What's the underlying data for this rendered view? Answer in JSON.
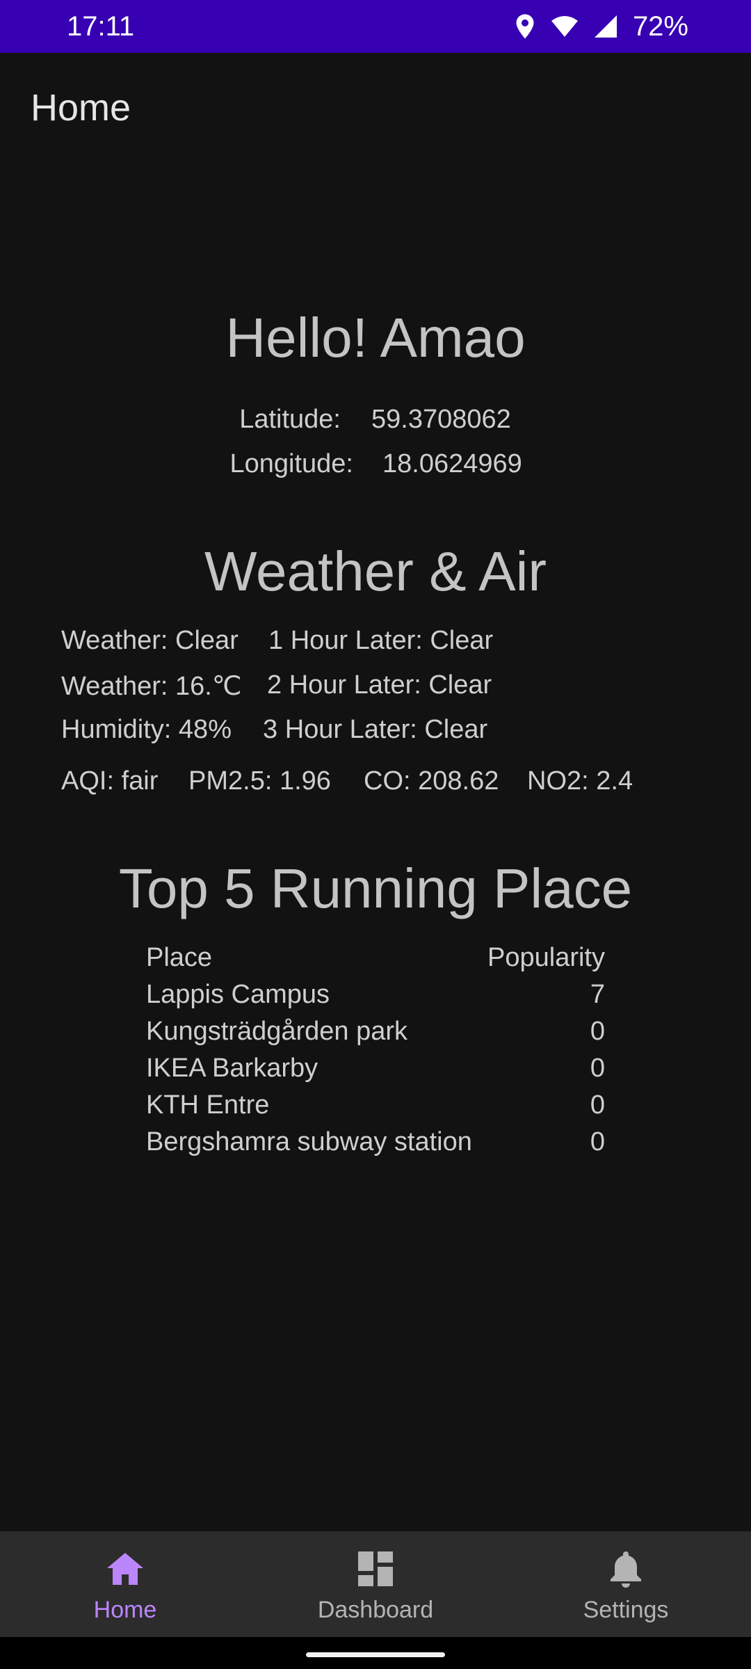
{
  "status_bar": {
    "time": "17:11",
    "battery": "72%",
    "icons": [
      "location-icon",
      "wifi-icon",
      "signal-icon"
    ]
  },
  "app_bar": {
    "title": "Home"
  },
  "greeting": "Hello! Amao",
  "location": {
    "latitude_label": "Latitude:",
    "latitude_value": "59.3708062",
    "longitude_label": "Longitude:",
    "longitude_value": "18.0624969"
  },
  "weather_section": {
    "title": "Weather & Air",
    "rows": [
      {
        "left": "Weather: Clear",
        "right": "1 Hour Later: Clear"
      },
      {
        "left": "Weather: 16.℃",
        "right": "2 Hour Later: Clear"
      },
      {
        "left": "Humidity: 48%",
        "right": "3 Hour Later: Clear"
      }
    ],
    "air": {
      "aqi": "AQI: fair",
      "pm25": "PM2.5: 1.96",
      "co": "CO: 208.62",
      "no2": "NO2: 2.4"
    }
  },
  "places_section": {
    "title": "Top 5 Running Place",
    "header": {
      "place": "Place",
      "popularity": "Popularity"
    },
    "rows": [
      {
        "place": "Lappis Campus",
        "popularity": "7"
      },
      {
        "place": "Kungsträdgården park",
        "popularity": "0"
      },
      {
        "place": "IKEA Barkarby",
        "popularity": "0"
      },
      {
        "place": "KTH Entre",
        "popularity": "0"
      },
      {
        "place": "Bergshamra subway station",
        "popularity": "0"
      }
    ]
  },
  "bottom_nav": {
    "items": [
      {
        "label": "Home",
        "icon": "home-icon",
        "active": true
      },
      {
        "label": "Dashboard",
        "icon": "dashboard-icon",
        "active": false
      },
      {
        "label": "Settings",
        "icon": "bell-icon",
        "active": false
      }
    ]
  },
  "colors": {
    "status_bar": "#3700b3",
    "background": "#121212",
    "nav_background": "#2c2c2c",
    "accent": "#bb86fc"
  }
}
